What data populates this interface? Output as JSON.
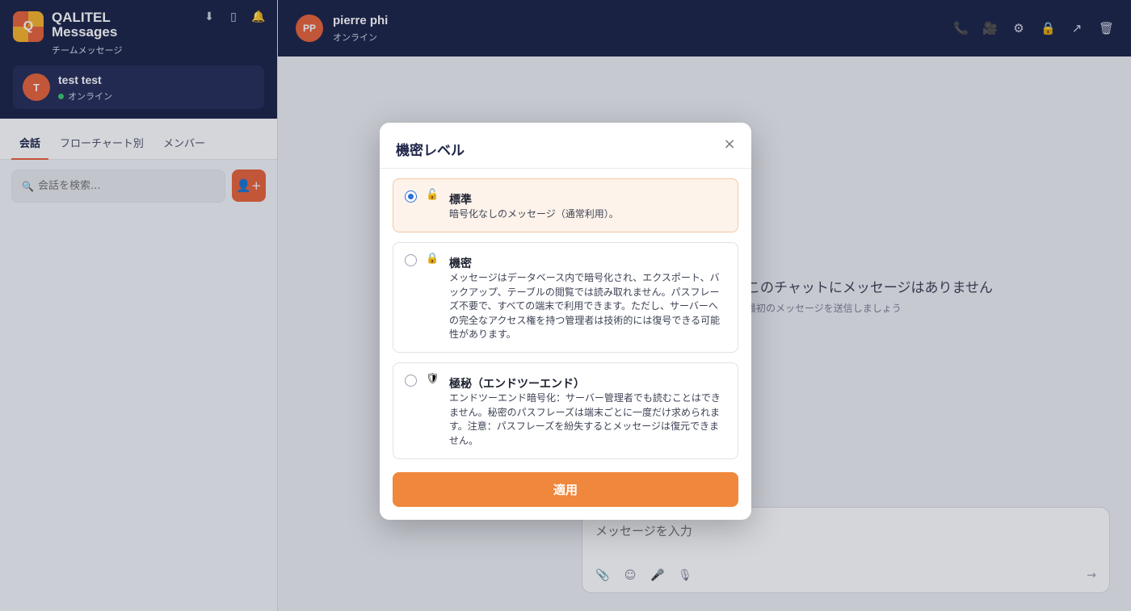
{
  "sidebar": {
    "app_title": "QALITEL Messages",
    "logo_letter": "Q",
    "app_subtitle": "チームメッセージ",
    "icons": [
      "download-icon",
      "mobile-icon",
      "bell-icon"
    ],
    "user": {
      "initial": "T",
      "name": "test test",
      "status": "オンライン"
    },
    "tabs": [
      {
        "label": "会話",
        "active": true
      },
      {
        "label": "フローチャート別",
        "active": false
      },
      {
        "label": "メンバー",
        "active": false
      }
    ],
    "search_placeholder": "会話を検索...",
    "add_button_icon": "add-user-icon"
  },
  "chat": {
    "contact": {
      "initials": "PP",
      "name": "pierre phi",
      "status": "オンライン"
    },
    "header_icons": [
      "phone-icon",
      "video-icon",
      "gear-icon",
      "lock-icon",
      "share-icon",
      "trash-icon"
    ],
    "empty_title": "このチャットにメッセージはありません",
    "empty_subtitle": "最初のメッセージを送信しましょう",
    "composer_placeholder": "メッセージを入力",
    "composer_tools": [
      "paperclip-icon",
      "emoji-icon",
      "mic-icon",
      "voice-icon"
    ],
    "send_icon": "send-arrow-icon"
  },
  "modal": {
    "title": "機密レベル",
    "close": "×",
    "options": [
      {
        "title": "標準",
        "desc": "暗号化なしのメッセージ（通常利用）。",
        "icon": "unlock-icon",
        "selected": true
      },
      {
        "title": "機密",
        "desc": "メッセージはデータベース内で暗号化され、エクスポート、バックアップ、テーブルの閲覧では読み取れません。パスフレーズ不要で、すべての端末で利用できます。ただし、サーバーへの完全なアクセス権を持つ管理者は技術的には復号できる可能性があります。",
        "icon": "lock-icon",
        "selected": false
      },
      {
        "title": "極秘（エンドツーエンド）",
        "desc": "エンドツーエンド暗号化：サーバー管理者でも読むことはできません。秘密のパスフレーズは端末ごとに一度だけ求められます。注意：パスフレーズを紛失するとメッセージは復元できません。",
        "icon": "shield-icon",
        "selected": false
      }
    ],
    "apply_label": "適用"
  },
  "colors": {
    "navy": "#1c2448",
    "accent": "#e8633a",
    "apply": "#ef873c",
    "radio": "#2f6fd6"
  }
}
